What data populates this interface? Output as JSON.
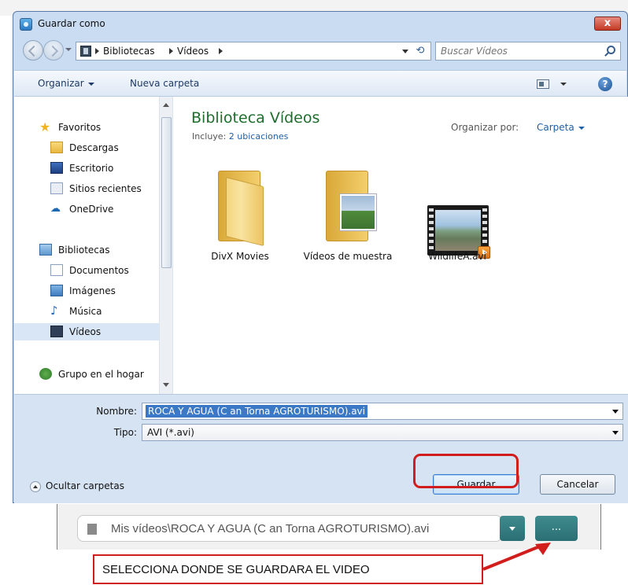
{
  "window": {
    "title": "Guardar como",
    "close_glyph": "x"
  },
  "address": {
    "crumbs": [
      "Bibliotecas",
      "Vídeos"
    ],
    "search_placeholder": "Buscar Vídeos"
  },
  "toolbar": {
    "organize": "Organizar",
    "new_folder": "Nueva carpeta",
    "help_glyph": "?"
  },
  "sidebar": {
    "favorites": "Favoritos",
    "items_fav": [
      "Descargas",
      "Escritorio",
      "Sitios recientes",
      "OneDrive"
    ],
    "libraries": "Bibliotecas",
    "items_lib": [
      "Documentos",
      "Imágenes",
      "Música",
      "Vídeos"
    ],
    "homegroup": "Grupo en el hogar",
    "selected": "Vídeos"
  },
  "library": {
    "title": "Biblioteca Vídeos",
    "includes_label": "Incluye:",
    "includes_link": "2 ubicaciones",
    "arrange_label": "Organizar por:",
    "arrange_value": "Carpeta"
  },
  "files": [
    {
      "label": "DivX Movies",
      "kind": "folder"
    },
    {
      "label": "Vídeos de muestra",
      "kind": "folder-photo"
    },
    {
      "label": "WildlifeA.avi",
      "kind": "video"
    }
  ],
  "form": {
    "name_label": "Nombre:",
    "name_value": "ROCA Y AGUA  (C an Torna AGROTURISMO).avi",
    "type_label": "Tipo:",
    "type_value": "AVI (*.avi)",
    "hide_folders": "Ocultar carpetas",
    "save": "Guardar",
    "cancel": "Cancelar"
  },
  "lower": {
    "path_text": "Mis vídeos\\ROCA Y AGUA  (C an Torna AGROTURISMO).avi",
    "browse_label": "...",
    "annotation": "SELECCIONA DONDE SE GUARDARA EL VIDEO"
  },
  "colors": {
    "library_title": "#1e6d2c",
    "link": "#1d5fa8",
    "annotation_red": "#d21d1d",
    "teal_button": "#2a6f73"
  }
}
